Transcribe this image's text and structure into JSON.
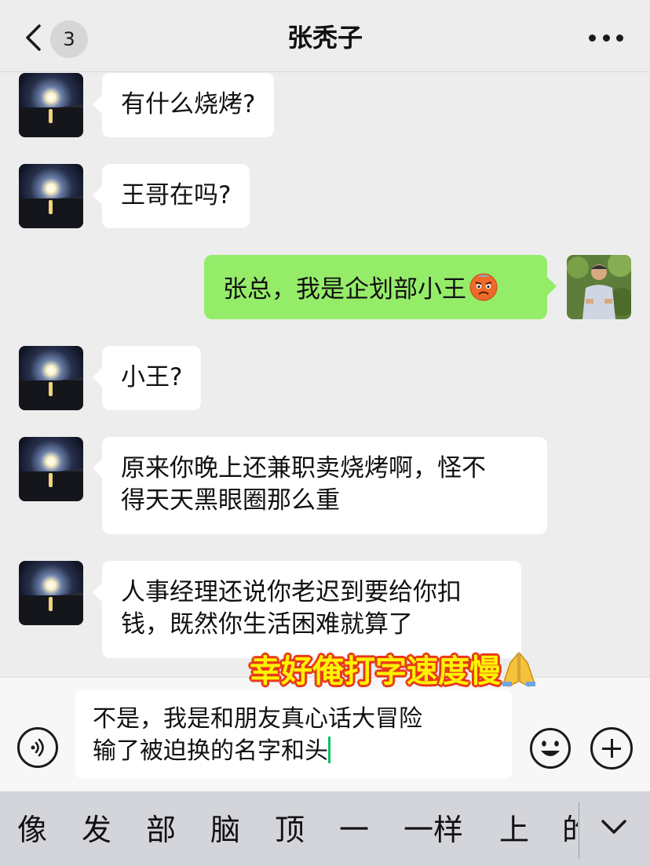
{
  "header": {
    "unread_count": "3",
    "title": "张秃子"
  },
  "messages": [
    {
      "side": "left",
      "text": "有什么烧烤?"
    },
    {
      "side": "left",
      "text": "王哥在吗?"
    },
    {
      "side": "right",
      "text": "张总，我是企划部小王",
      "emoji": "angry-face-emoji"
    },
    {
      "side": "left",
      "text": "小王?"
    },
    {
      "side": "left",
      "line1": "原来你晚上还兼职卖烧烤啊，怪不",
      "line2": "得天天黑眼圈那么重"
    },
    {
      "side": "left",
      "line1": "人事经理还说你老迟到要给你扣",
      "line2": "钱，既然你生活困难就算了"
    }
  ],
  "caption": {
    "text": "幸好俺打字速度慢",
    "emoji": "folded-hands-emoji"
  },
  "input": {
    "line1": "不是，我是和朋友真心话大冒险",
    "line2": "输了被迫换的名字和头"
  },
  "candidates": [
    "像",
    "发",
    "部",
    "脑",
    "顶",
    "一",
    "一样",
    "上",
    "的"
  ],
  "colors": {
    "background": "#ededed",
    "bubble_left": "#ffffff",
    "bubble_right": "#95ec69",
    "caret": "#07c160",
    "caption_fill": "#fff200",
    "caption_outline": "#e8381a"
  }
}
